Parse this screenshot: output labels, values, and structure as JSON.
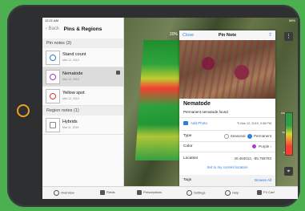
{
  "status": {
    "time": "12:21 AM",
    "battery": "58%"
  },
  "sidebar": {
    "back_label": "Back",
    "title": "Pins & Regions",
    "pin_section": "Pin notes (3)",
    "region_section": "Region notes (1)",
    "pins": [
      {
        "name": "Stand count",
        "date": "Mar 12, 2019",
        "color": "#2f7fe0"
      },
      {
        "name": "Nematode",
        "date": "Mar 12, 2019",
        "color": "#a83cc8"
      },
      {
        "name": "Yellow spot",
        "date": "Mar 12, 2019",
        "color": "#e53935"
      }
    ],
    "regions": [
      {
        "name": "Hybrids",
        "date": "Mar 11, 2019"
      }
    ]
  },
  "map": {
    "percent_label": "20%",
    "legend": [
      "100",
      "50",
      "0"
    ]
  },
  "note": {
    "close_label": "Close",
    "title": "Pin Note",
    "name": "Nematode",
    "description": "Permanent nematode found",
    "add_photo": "Add Photo",
    "date": "Mar 12, 2019, 3:38 PM",
    "type_label": "Type",
    "type_options": [
      "Seasonal",
      "Permanent"
    ],
    "type_selected": "Permanent",
    "color_label": "Color",
    "color_value": "Purple",
    "color_hex": "#a83cc8",
    "location_label": "Location",
    "location_value": "40.463012, -85.758783",
    "set_location": "Set to my current location",
    "tags_label": "Tags",
    "browse_all": "Browse All"
  },
  "tabs": [
    "Overview",
    "Fields",
    "Prescriptions",
    "Settings",
    "Help",
    "FV Cart"
  ]
}
